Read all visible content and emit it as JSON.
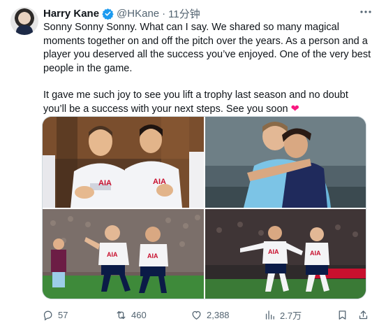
{
  "author": {
    "name": "Harry Kane",
    "handle": "@HKane",
    "separator": "·",
    "time": "11分钟"
  },
  "tweet": {
    "paragraph1": "Sonny Sonny Sonny. What can I say. We shared so many magical moments together on and off the pitch over the years. As a person and a player you deserved all the success you’ve enjoyed. One of the very best people in the game.",
    "paragraph2": "It gave me such joy to see you lift a trophy last season and no doubt you’ll be a success with your next steps. See you soon",
    "heart_emoji": "❤"
  },
  "media": {
    "photos": [
      {
        "jersey_text": "AIA"
      },
      {
        "jersey_text": ""
      },
      {
        "jersey_text": "AIA"
      },
      {
        "jersey_text": "AIA"
      }
    ]
  },
  "actions": {
    "replies": "57",
    "reposts": "460",
    "likes": "2,388",
    "views": "2.7万"
  },
  "colors": {
    "text": "#0f1419",
    "secondary": "#536471",
    "verified": "#1d9bf0",
    "heart": "#f91880",
    "border": "#cfd9de"
  },
  "icons": [
    "verified-badge-icon",
    "more-options-icon",
    "reply-icon",
    "repost-icon",
    "like-icon",
    "views-icon",
    "bookmark-icon",
    "share-icon"
  ]
}
